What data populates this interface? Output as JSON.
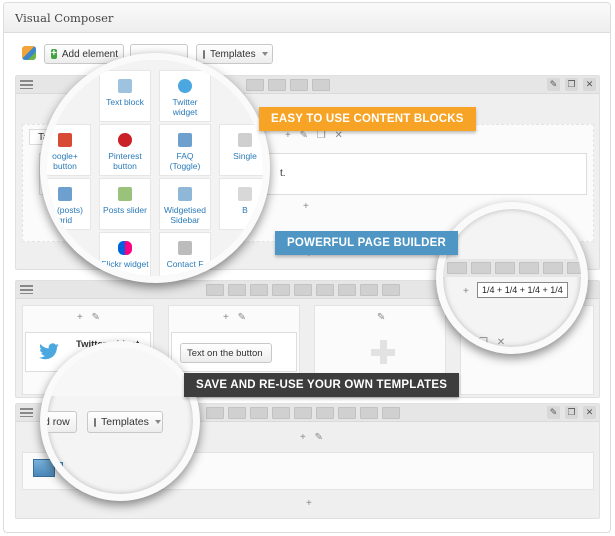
{
  "panel": {
    "title": "Visual Composer"
  },
  "toolbar": {
    "add_element": "Add element",
    "templates": "Templates"
  },
  "badges": {
    "content_blocks": "EASY TO USE CONTENT BLOCKS",
    "page_builder": "POWERFUL PAGE BUILDER",
    "templates": "SAVE AND RE-USE YOUR OWN TEMPLATES"
  },
  "colors": {
    "orange": "#f7a325",
    "blue": "#4f96c4",
    "dark": "#3d3d3d",
    "link": "#2a7ab9"
  },
  "row1": {
    "tab_label": "Tab"
  },
  "row2": {
    "twitter_widget": "Twitter widget",
    "button_text": "Text on the button"
  },
  "row3": {
    "add_row": "d row",
    "templates": "Templates"
  },
  "lens_blocks": {
    "cells": [
      {
        "label": "Text block",
        "icon": "text-block-icon"
      },
      {
        "label": "Twitter widget",
        "icon": "twitter-icon"
      },
      {
        "label": "oogle+ button",
        "icon": "google-plus-icon"
      },
      {
        "label": "Pinterest button",
        "icon": "pinterest-icon"
      },
      {
        "label": "FAQ (Toggle)",
        "icon": "faq-icon"
      },
      {
        "label": "Single",
        "icon": "single-icon"
      },
      {
        "label": "er (posts) grid",
        "icon": "grid-icon"
      },
      {
        "label": "Posts slider",
        "icon": "slider-icon"
      },
      {
        "label": "Widgetised Sidebar",
        "icon": "sidebar-icon"
      },
      {
        "label": "B",
        "icon": "b-icon"
      },
      {
        "label": "Flickr widget",
        "icon": "flickr-icon"
      },
      {
        "label": "Contact F",
        "icon": "contact-icon"
      }
    ]
  },
  "lens_layout": {
    "layout_label": "1/4 + 1/4 + 1/4 + 1/4"
  },
  "misc": {
    "fragment_t": "t."
  }
}
